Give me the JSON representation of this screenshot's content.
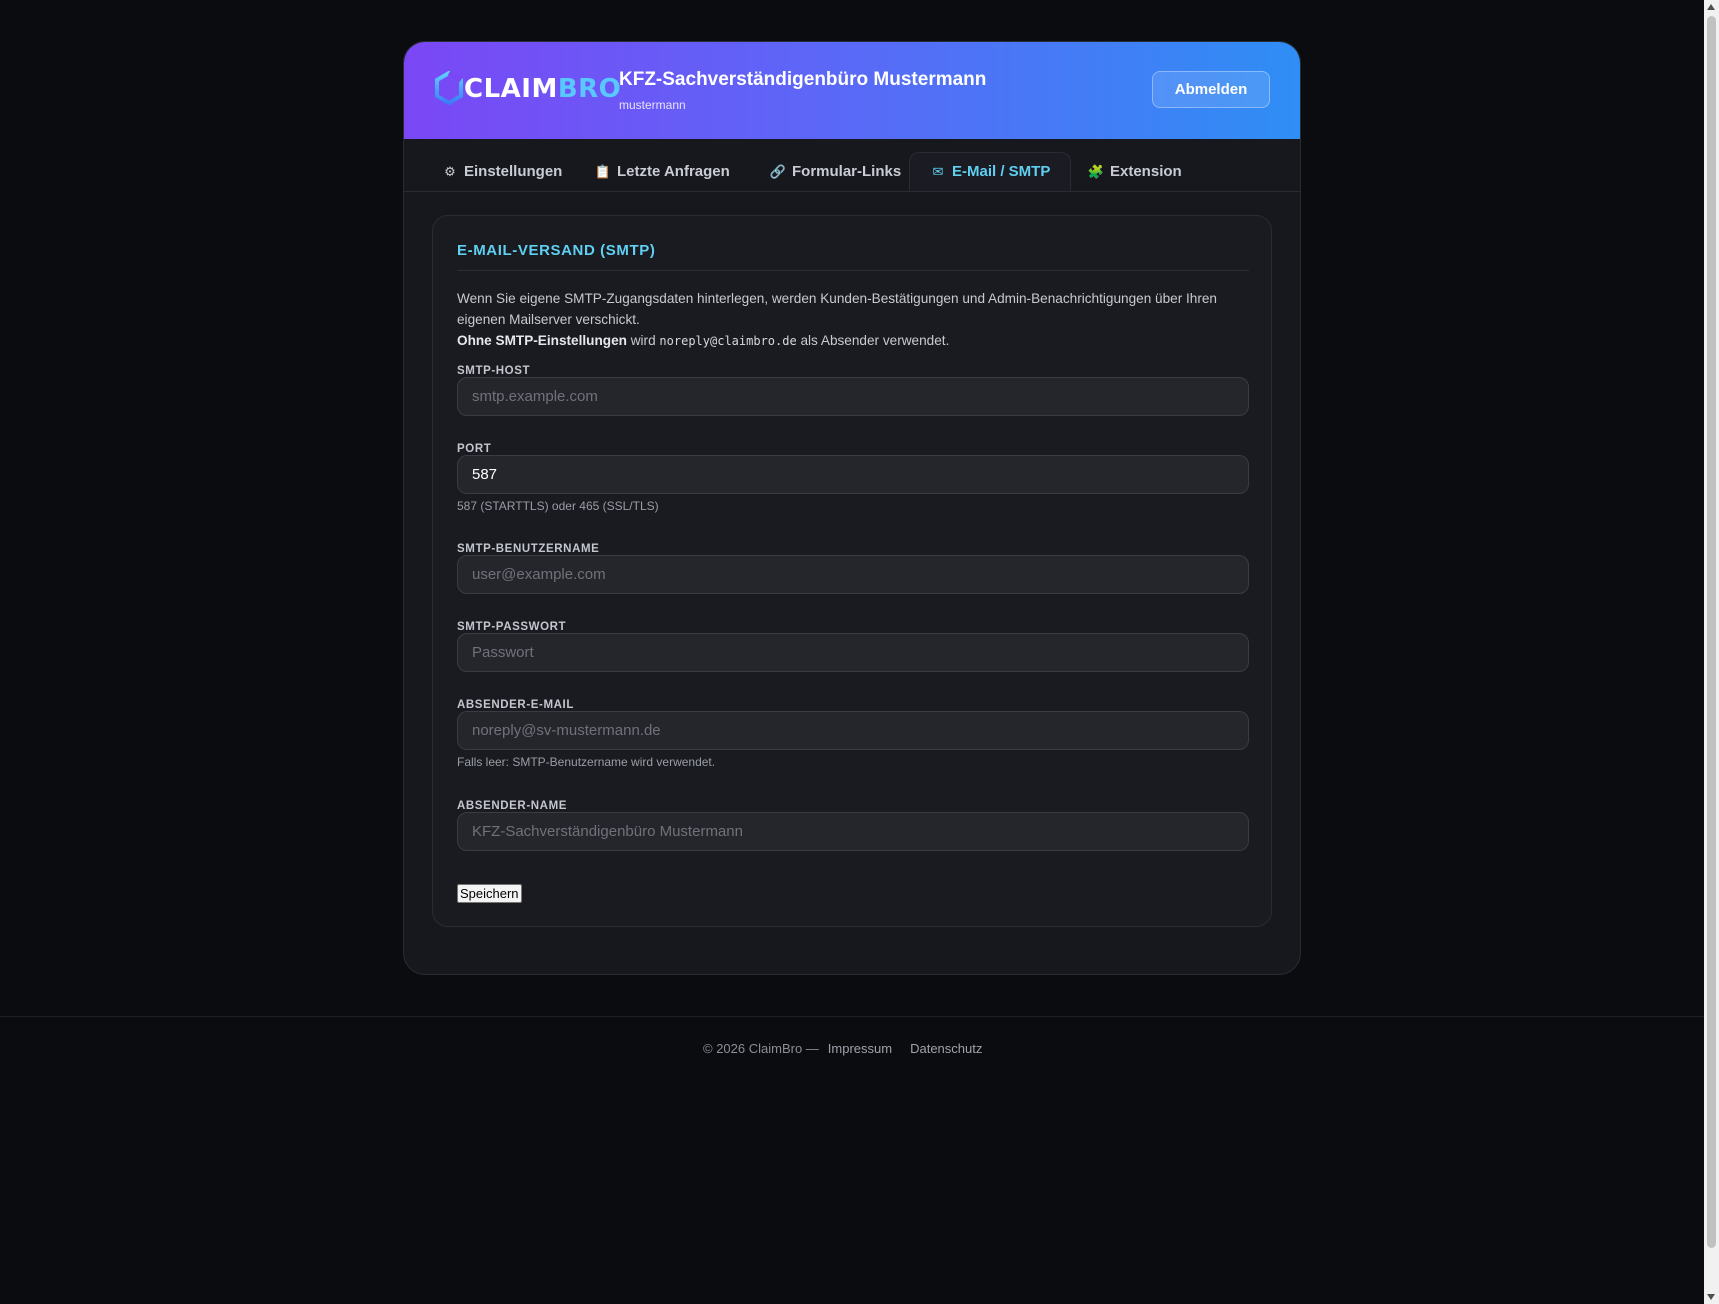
{
  "header": {
    "logo_part1": "CLAIM",
    "logo_part2": "BRO",
    "org_title": "KFZ-Sachverständigenbüro Mustermann",
    "username": "mustermann",
    "logout_label": "Abmelden"
  },
  "tabs": [
    {
      "icon": "gear-icon",
      "glyph": "⚙",
      "label": "Einstellungen"
    },
    {
      "icon": "clipboard-icon",
      "glyph": "📋",
      "label": "Letzte Anfragen"
    },
    {
      "icon": "link-icon",
      "glyph": "🔗",
      "label": "Formular-Links"
    },
    {
      "icon": "envelope-icon",
      "glyph": "✉",
      "label": "E-Mail / SMTP",
      "active": true
    },
    {
      "icon": "puzzle-icon",
      "glyph": "🧩",
      "label": "Extension"
    }
  ],
  "section": {
    "title": "E-MAIL-VERSAND (SMTP)",
    "intro_line1": "Wenn Sie eigene SMTP-Zugangsdaten hinterlegen, werden Kunden-Bestätigungen und Admin-Benachrichtigungen über Ihren eigenen Mailserver verschickt.",
    "intro_bold": "Ohne SMTP-Einstellungen",
    "intro_mid": " wird ",
    "intro_code": "noreply@claimbro.de",
    "intro_end": " als Absender verwendet."
  },
  "fields": {
    "host": {
      "label": "SMTP-HOST",
      "value": "",
      "placeholder": "smtp.example.com"
    },
    "port": {
      "label": "PORT",
      "value": "587",
      "placeholder": "",
      "hint": "587 (STARTTLS) oder 465 (SSL/TLS)"
    },
    "user": {
      "label": "SMTP-BENUTZERNAME",
      "value": "",
      "placeholder": "user@example.com"
    },
    "password": {
      "label": "SMTP-PASSWORT",
      "value": "",
      "placeholder": "Passwort"
    },
    "sender_email": {
      "label": "ABSENDER-E-MAIL",
      "value": "",
      "placeholder": "noreply@sv-mustermann.de",
      "hint": "Falls leer: SMTP-Benutzername wird verwendet."
    },
    "sender_name": {
      "label": "ABSENDER-NAME",
      "value": "",
      "placeholder": "KFZ-Sachverständigenbüro Mustermann"
    }
  },
  "save_label": "Speichern",
  "footer": {
    "copyright": "© 2026 ClaimBro —",
    "impressum": "Impressum",
    "datenschutz": "Datenschutz"
  },
  "colors": {
    "accent": "#5fd0f2",
    "gradient_start": "#7b47f5",
    "gradient_end": "#2f8ef5",
    "background": "#0b0c10"
  }
}
